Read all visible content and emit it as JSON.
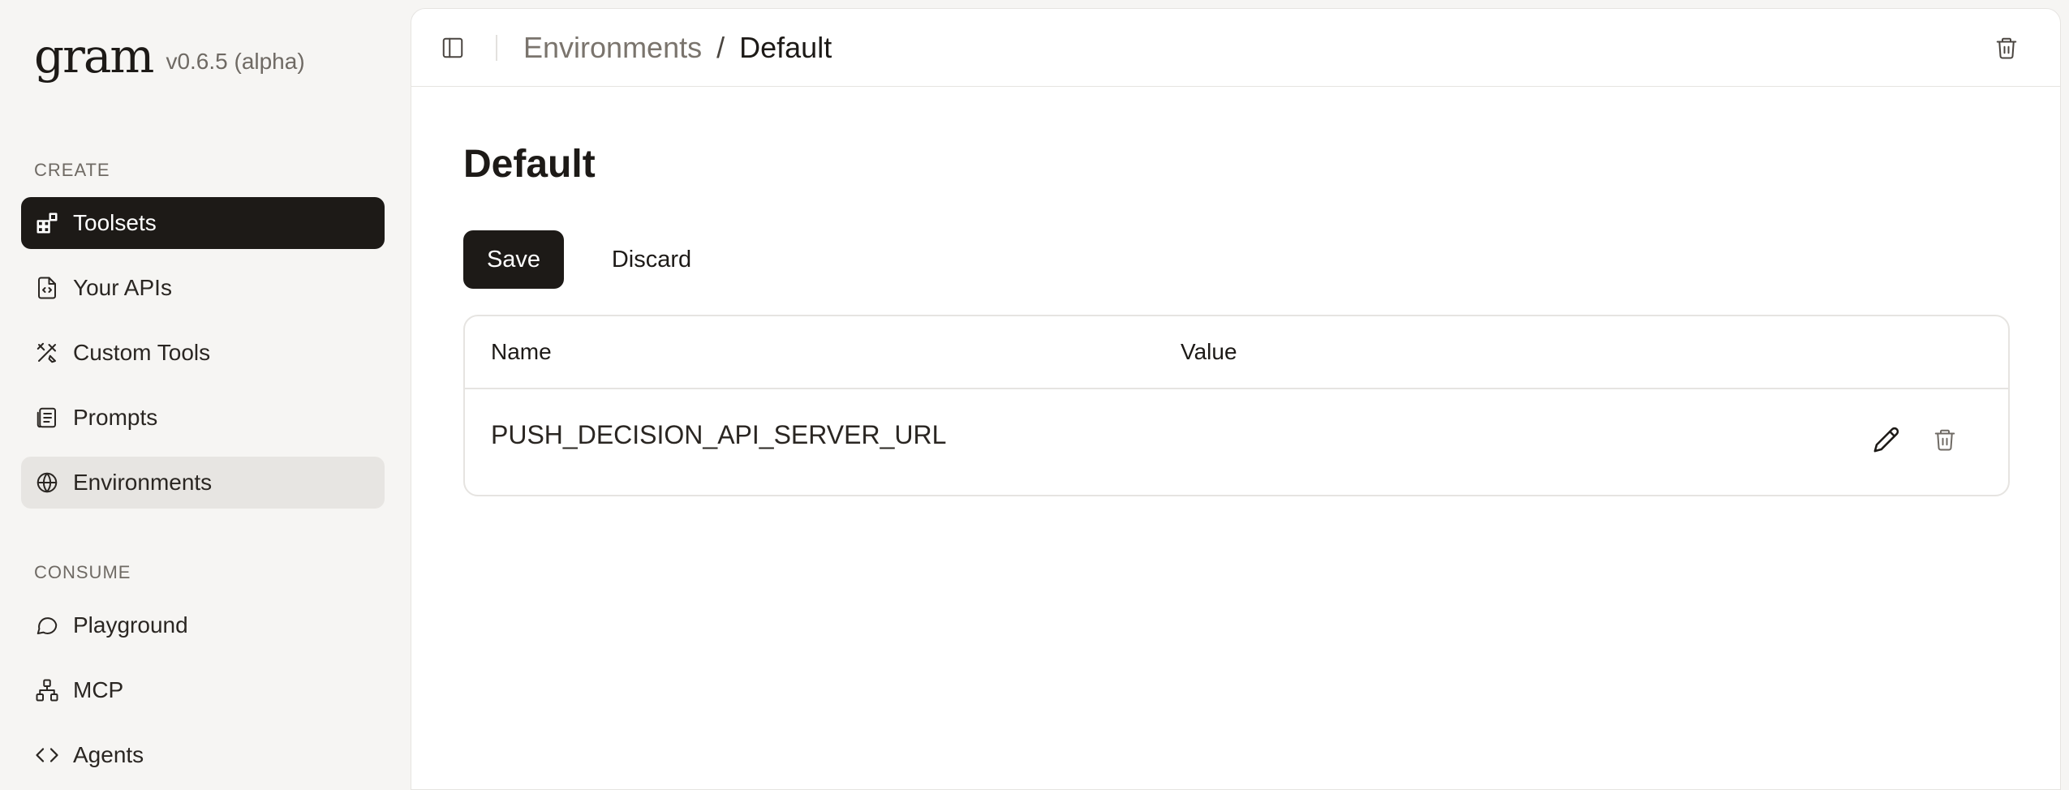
{
  "app": {
    "logo_text": "gram",
    "version": "v0.6.5 (alpha)"
  },
  "sidebar": {
    "sections": [
      {
        "label": "CREATE",
        "items": [
          {
            "label": "Toolsets",
            "icon": "toolsets-icon",
            "state": "active"
          },
          {
            "label": "Your APIs",
            "icon": "file-code-icon",
            "state": "normal"
          },
          {
            "label": "Custom Tools",
            "icon": "tools-icon",
            "state": "normal"
          },
          {
            "label": "Prompts",
            "icon": "prompts-icon",
            "state": "normal"
          },
          {
            "label": "Environments",
            "icon": "globe-icon",
            "state": "selected"
          }
        ]
      },
      {
        "label": "CONSUME",
        "items": [
          {
            "label": "Playground",
            "icon": "chat-bubble-icon",
            "state": "normal"
          },
          {
            "label": "MCP",
            "icon": "network-icon",
            "state": "normal"
          },
          {
            "label": "Agents",
            "icon": "code-brackets-icon",
            "state": "normal"
          }
        ]
      }
    ]
  },
  "header": {
    "breadcrumb": {
      "parent": "Environments",
      "separator": "/",
      "current": "Default"
    }
  },
  "main": {
    "title": "Default",
    "actions": {
      "save_label": "Save",
      "discard_label": "Discard"
    },
    "table": {
      "columns": [
        "Name",
        "Value"
      ],
      "rows": [
        {
          "name": "PUSH_DECISION_API_SERVER_URL",
          "value": ""
        }
      ]
    }
  },
  "colors": {
    "accent": "#1d1a17",
    "background": "#f6f5f3",
    "panel": "#ffffff",
    "muted_text": "#7a746d",
    "selected_bg": "#e7e5e2"
  }
}
